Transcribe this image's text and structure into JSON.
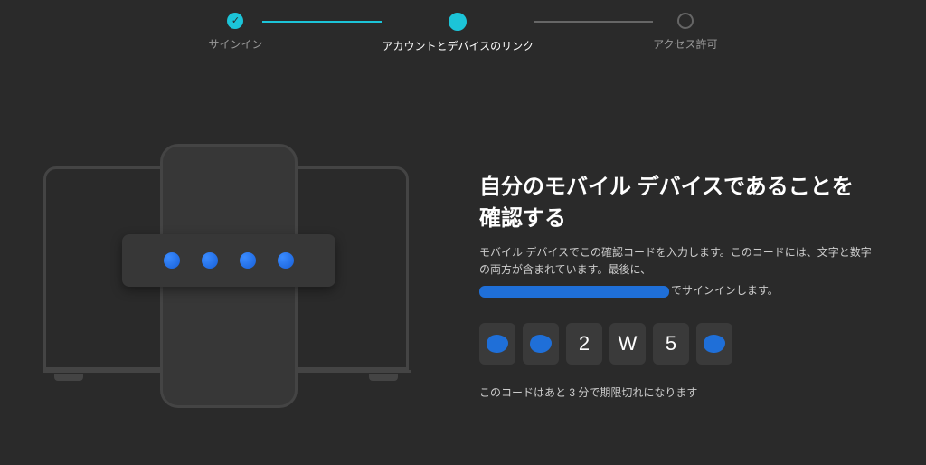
{
  "stepper": {
    "step1": {
      "label": "サインイン",
      "state": "complete"
    },
    "step2": {
      "label": "アカウントとデバイスのリンク",
      "state": "active"
    },
    "step3": {
      "label": "アクセス許可",
      "state": "pending"
    }
  },
  "verify": {
    "heading": "自分のモバイル デバイスであることを確認する",
    "desc_line1": "モバイル デバイスでこの確認コードを入力します。このコードには、文字と数字の両方が含まれています。最後に、",
    "desc_line2_suffix": "でサインインします。",
    "expiry": "このコードはあと 3 分で期限切れになります"
  },
  "code": {
    "chars": [
      "",
      "",
      "2",
      "W",
      "5",
      ""
    ],
    "redacted_indices": [
      0,
      1,
      5
    ]
  }
}
